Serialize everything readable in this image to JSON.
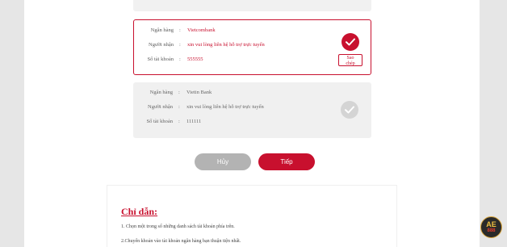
{
  "labels": {
    "bank": "Ngân hàng",
    "receiver": "Người nhận",
    "account": "Số tài khoản",
    "colon": ":"
  },
  "accounts": [
    {
      "bank": "Vietcombank",
      "receiver": "xin vui lòng liên hệ hỗ trợ trực tuyến",
      "account_number": "555555",
      "selected": true,
      "copy_label": "Sao\nchép"
    },
    {
      "bank": "Vietin Bank",
      "receiver": "xin vui lòng liên hệ hỗ trợ trực tuyến",
      "account_number": "111111",
      "selected": false
    }
  ],
  "actions": {
    "cancel_label": "Hủy",
    "next_label": "Tiếp"
  },
  "guide": {
    "title": "Chỉ dẫn:",
    "items": [
      "1. Chọn một trong số những danh sách tài khoản phía trên.",
      "2.Chuyển khoản vào tài khoản ngân hàng bạn thuận tiện nhất."
    ]
  },
  "logo": {
    "line1": "AE",
    "line2": "888"
  },
  "colors": {
    "accent": "#c8102e",
    "muted_button": "#b3b3b3",
    "unselected_card": "#f0f0f0"
  },
  "icons": {
    "selected_check": "check-icon",
    "unselected_check": "check-icon"
  }
}
